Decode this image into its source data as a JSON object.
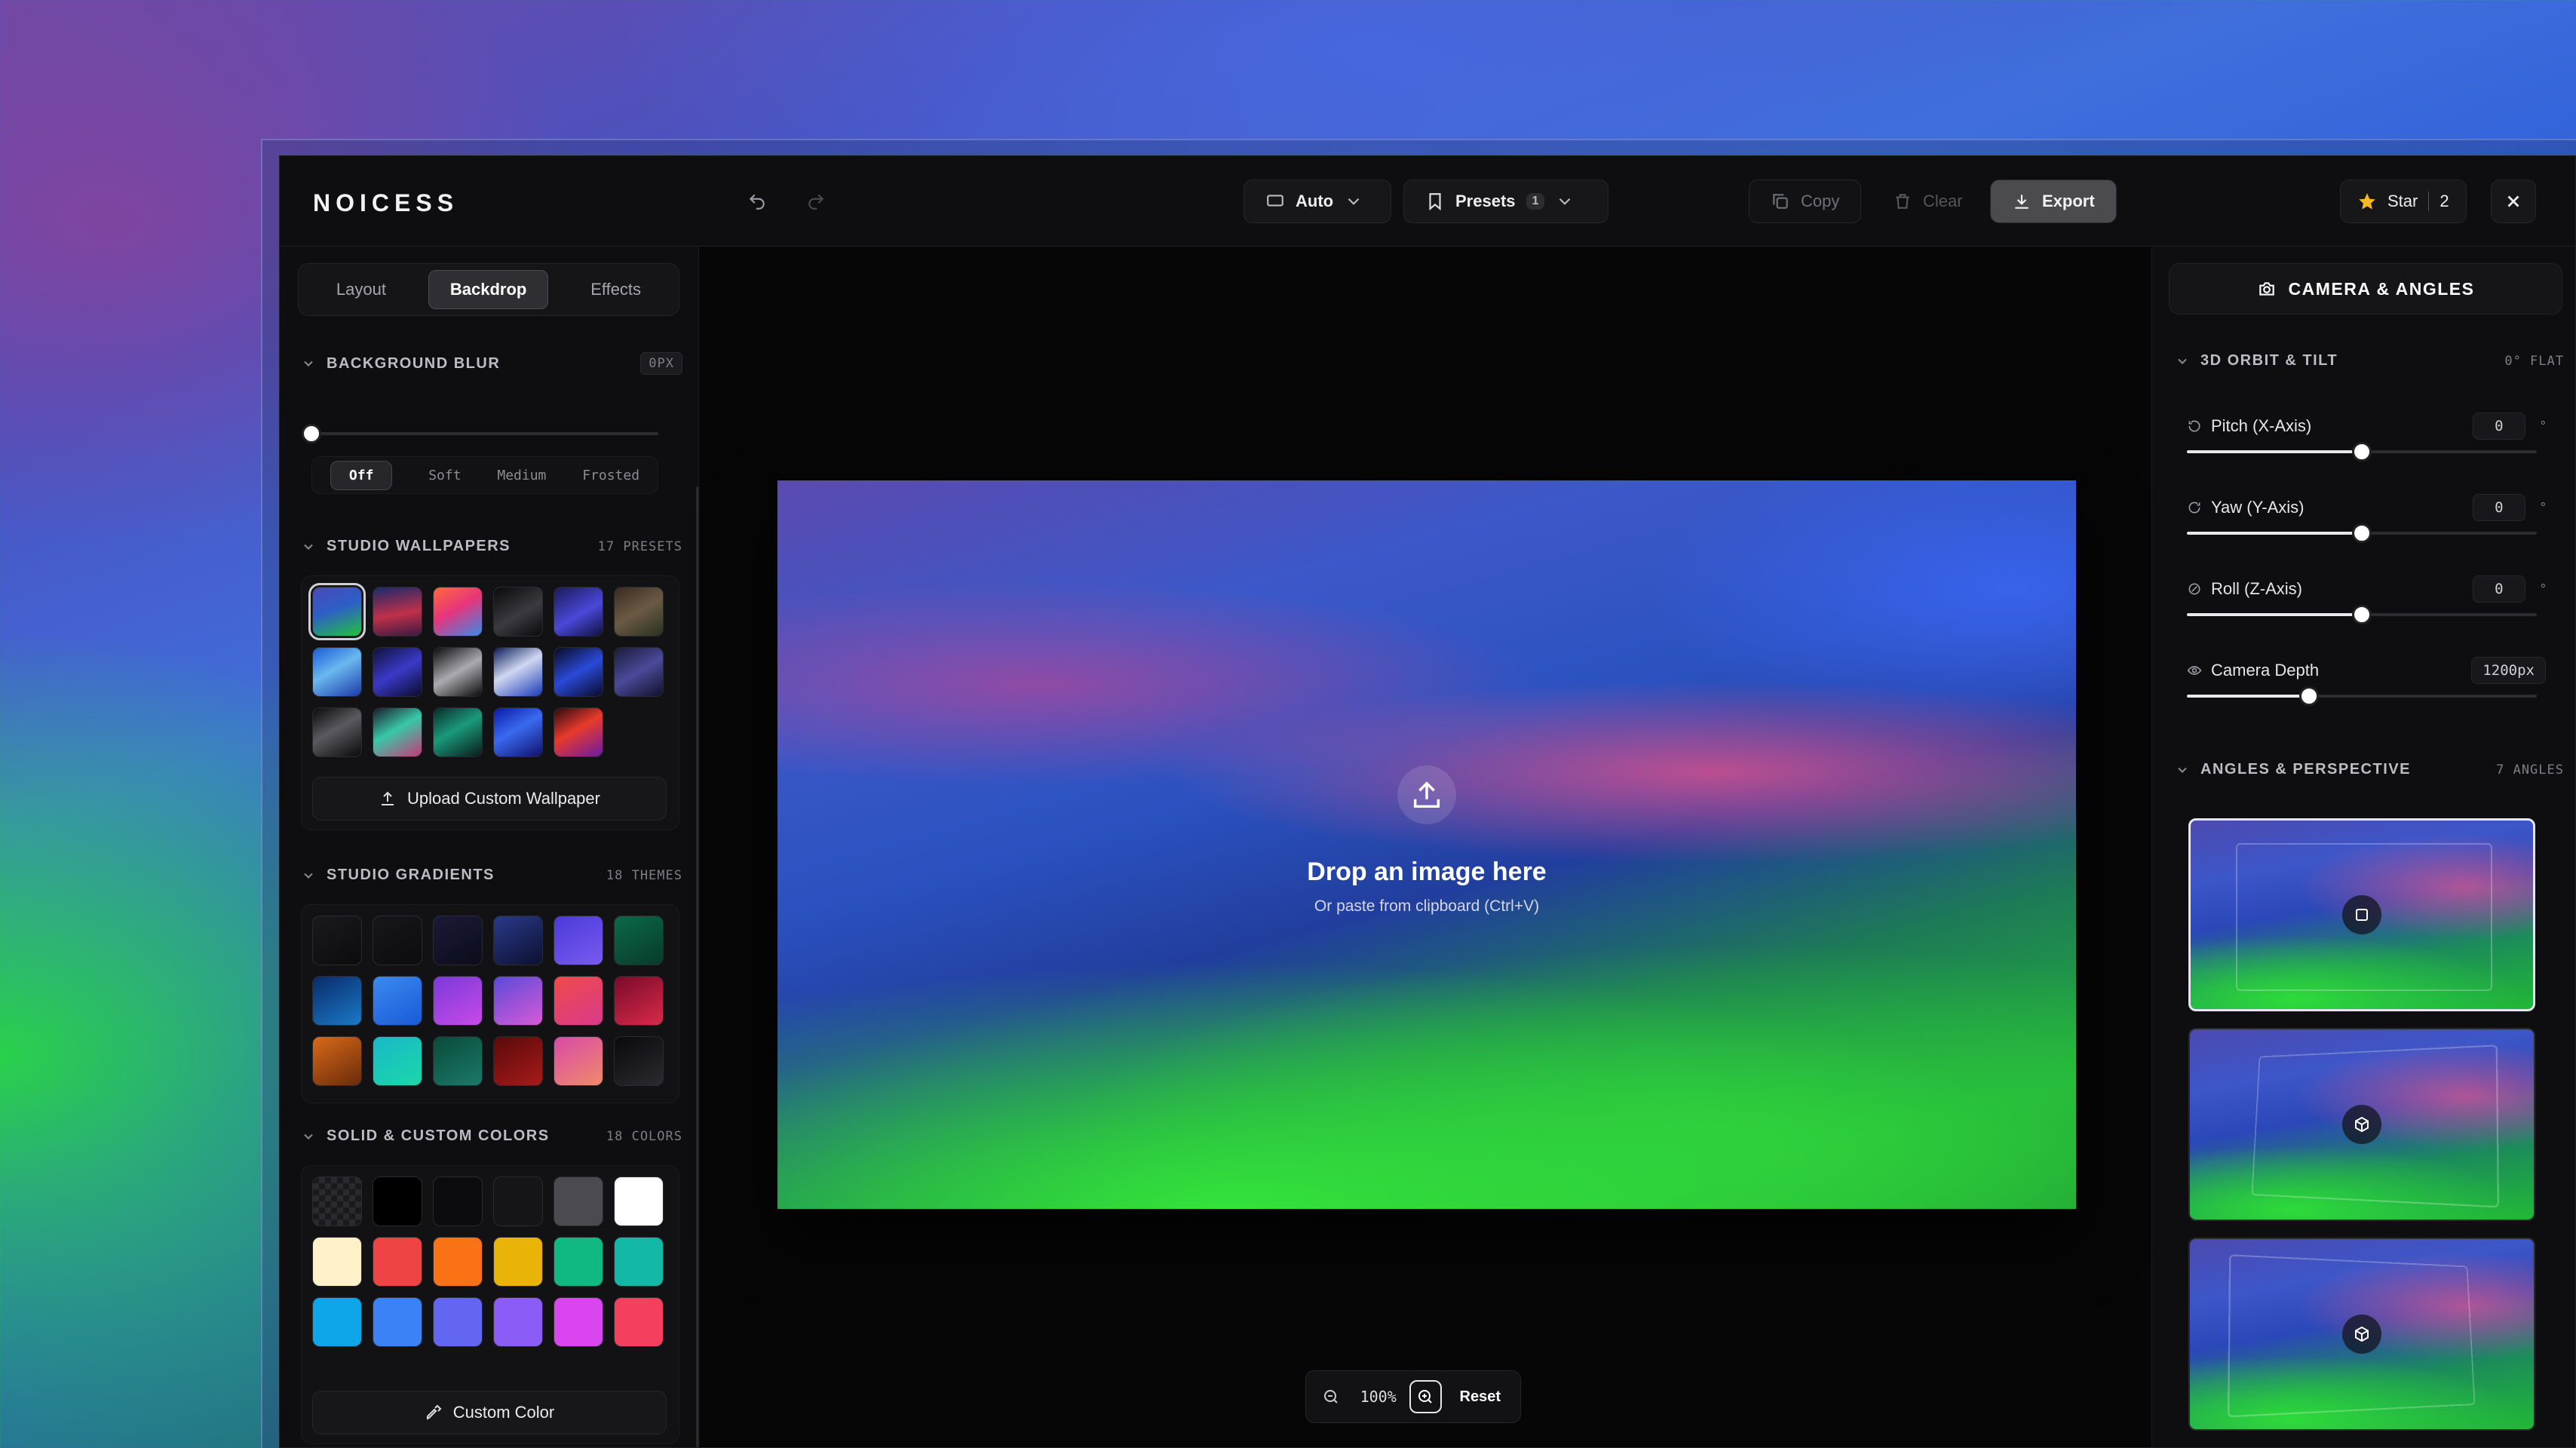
{
  "app": {
    "logo": "NOICESS"
  },
  "toolbar": {
    "mode_label": "Auto",
    "presets_label": "Presets",
    "presets_count": "1",
    "copy_label": "Copy",
    "clear_label": "Clear",
    "export_label": "Export",
    "star_label": "Star",
    "star_count": "2"
  },
  "left_tabs": [
    "Layout",
    "Backdrop",
    "Effects"
  ],
  "left_active_tab": "Backdrop",
  "background_blur": {
    "title": "BACKGROUND BLUR",
    "value": "0PX",
    "level": 0,
    "options": [
      "Off",
      "Soft",
      "Medium",
      "Frosted"
    ],
    "selected": "Off"
  },
  "studio_wallpapers": {
    "title": "STUDIO WALLPAPERS",
    "meta": "17 PRESETS",
    "swatches": [
      "linear-gradient(160deg,#4a4ab8,#2d5ec8 45%,#22c23c)",
      "linear-gradient(170deg,#1a2a6a,#c0304a 55%,#3a1a40)",
      "linear-gradient(150deg,#ff6a3a,#e8347a 45%,#3a8ae8)",
      "linear-gradient(150deg,#0a0a0c,#3a3a40 55%,#0a0a0c)",
      "linear-gradient(150deg,#1a1a5a,#4a48d8 55%,#101040)",
      "linear-gradient(150deg,#3a2a20,#6a5a44 50%,#2a3020)",
      "linear-gradient(150deg,#1a5ad8,#6ab8f0 45%,#1a3aa8)",
      "linear-gradient(150deg,#10103a,#3a3ac8 50%,#0a0a2a)",
      "linear-gradient(150deg,#0a0a0c,#aaaab0 50%,#0a0a0c)",
      "linear-gradient(150deg,#0a1a5a,#d0d8f0 45%,#1a3ab8)",
      "linear-gradient(150deg,#0a0a20,#2a4ad8 50%,#0a0a2a)",
      "linear-gradient(150deg,#1a1a3a,#4a4a9a 50%,#10102a)",
      "linear-gradient(150deg,#0a0a0c,#5a5a60 45%,#0a0a0c)",
      "linear-gradient(150deg,#1a1a2a,#38c8a8 45%,#c83878)",
      "linear-gradient(150deg,#0a2a2a,#1a9a7a 45%,#0a1a1a)",
      "linear-gradient(150deg,#0a1aa8,#3a6af0 45%,#10106a)",
      "linear-gradient(150deg,#2a0a10,#e83a2a 45%,#6a1aa8)"
    ],
    "selected_index": 0,
    "upload_label": "Upload Custom Wallpaper"
  },
  "studio_gradients": {
    "title": "STUDIO GRADIENTS",
    "meta": "18 THEMES",
    "swatches": [
      "linear-gradient(150deg,#1a1a1e,#0c0c0e)",
      "linear-gradient(150deg,#17171b,#0c0c0e)",
      "linear-gradient(150deg,#1a1a3a,#0c0c1a)",
      "linear-gradient(150deg,#2a3a8a,#0c1030)",
      "linear-gradient(150deg,#4a3ad8,#7a5af0)",
      "linear-gradient(150deg,#0a6a4a,#0a3a2a)",
      "linear-gradient(150deg,#0a2a6a,#1a7ac8)",
      "linear-gradient(150deg,#3a8af0,#1a5ad8)",
      "linear-gradient(150deg,#7a3ad8,#c84ae8)",
      "linear-gradient(150deg,#5a4ad8,#d85ad8)",
      "linear-gradient(150deg,#f04a4a,#d83a8a)",
      "linear-gradient(150deg,#7a0a2a,#d82a4a)",
      "linear-gradient(150deg,#d86a1a,#6a2a0a)",
      "linear-gradient(150deg,#1ab8c8,#1ad8a8)",
      "linear-gradient(150deg,#0a4a3a,#1a7a6a)",
      "linear-gradient(150deg,#5a0a0a,#a81a1a)",
      "linear-gradient(150deg,#d84aa8,#f08a6a)",
      "linear-gradient(150deg,#0a0a0c,#2a2a30)"
    ]
  },
  "solid_colors": {
    "title": "SOLID & CUSTOM COLORS",
    "meta": "18 COLORS",
    "swatches": [
      "transparent",
      "#000000",
      "#0c0c0e",
      "#151518",
      "#4a4a50",
      "#ffffff",
      "#fef0c8",
      "#ef4444",
      "#f97316",
      "#eab308",
      "#10b981",
      "#14b8a6",
      "#0ea5e9",
      "#3b82f6",
      "#6366f1",
      "#8b5cf6",
      "#d946ef",
      "#f43f5e"
    ],
    "custom_label": "Custom Color"
  },
  "canvas": {
    "drop_title": "Drop an image here",
    "drop_sub": "Or paste from clipboard (Ctrl+V)"
  },
  "zoom": {
    "value": "100%",
    "reset_label": "Reset"
  },
  "right": {
    "header": "CAMERA & ANGLES",
    "orbit": {
      "title": "3D ORBIT & TILT",
      "meta": "0° FLAT",
      "controls": [
        {
          "label": "Pitch (X-Axis)",
          "value": "0",
          "unit": "°",
          "level": 0.5
        },
        {
          "label": "Yaw (Y-Axis)",
          "value": "0",
          "unit": "°",
          "level": 0.5
        },
        {
          "label": "Roll (Z-Axis)",
          "value": "0",
          "unit": "°",
          "level": 0.5
        },
        {
          "label": "Camera Depth",
          "value": "1200px",
          "unit": "",
          "level": 0.35
        }
      ]
    },
    "angles": {
      "title": "ANGLES & PERSPECTIVE",
      "meta": "7 ANGLES",
      "selected_index": 0
    }
  }
}
